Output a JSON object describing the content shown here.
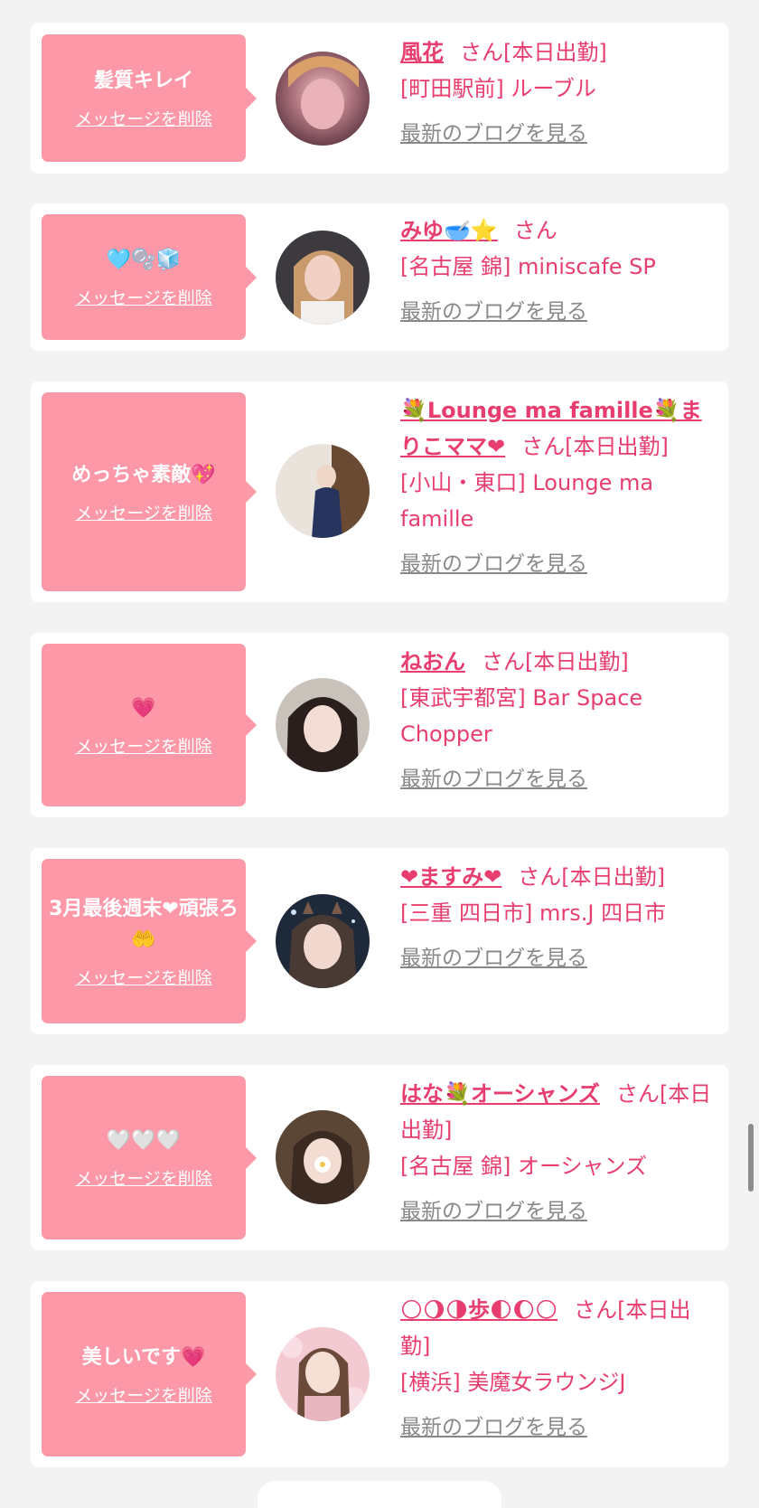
{
  "delete_label": "メッセージを削除",
  "blog_label": "最新のブログを見る",
  "honorific_label": "さん",
  "cards": [
    {
      "message": "髪質キレイ",
      "name": "風花",
      "status": "[本日出勤]",
      "shop": "[町田駅前] ルーブル"
    },
    {
      "message": "🩵🫧🧊",
      "name": "みゆ🥣⭐",
      "status": "",
      "shop": "[名古屋 錦] miniscafe SP"
    },
    {
      "message": "めっちゃ素敵💖",
      "name": "💐Lounge ma famille💐まりこママ❤",
      "status": "[本日出勤]",
      "shop": "[小山・東口] Lounge ma famille"
    },
    {
      "message": "💗",
      "name": "ねおん",
      "status": "[本日出勤]",
      "shop": "[東武宇都宮] Bar Space Chopper"
    },
    {
      "message": "3月最後週末❤頑張ろ🤲",
      "name": "❤ますみ❤",
      "status": "[本日出勤]",
      "shop": "[三重 四日市] mrs.J 四日市"
    },
    {
      "message": "🤍🤍🤍",
      "name": "はな💐オーシャンズ",
      "status": "[本日出勤]",
      "shop": "[名古屋 錦] オーシャンズ"
    },
    {
      "message": "美しいです💗",
      "name": "🌕🌖🌗歩🌓🌔🌕",
      "status": "[本日出勤]",
      "shop": "[横浜] 美魔女ラウンジJ"
    }
  ],
  "colors": {
    "accent_pink": "#e83e6f",
    "bubble_pink": "#fd98a9",
    "background": "#f3f3f3"
  }
}
